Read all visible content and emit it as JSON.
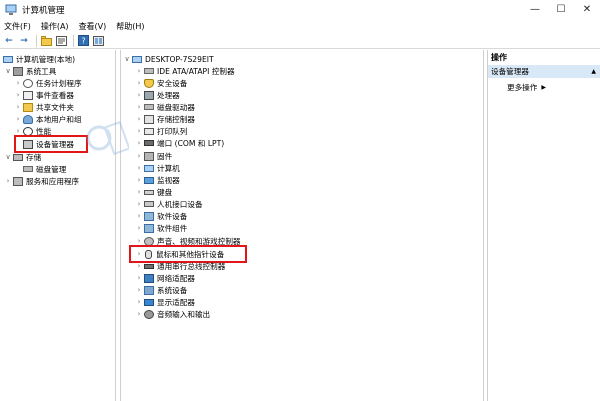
{
  "window": {
    "title": "计算机管理",
    "controls": {
      "minimize": "—",
      "maximize": "☐",
      "close": "✕"
    }
  },
  "menu": [
    "文件(F)",
    "操作(A)",
    "查看(V)",
    "帮助(H)"
  ],
  "toolbar": {
    "back_icon": "←",
    "forward_icon": "→",
    "icons": [
      "folder-up-icon",
      "properties-icon",
      "help-icon",
      "refresh-icon"
    ]
  },
  "left_tree": {
    "root": "计算机管理(本地)",
    "items": [
      {
        "label": "系统工具",
        "icon": "tools-icon",
        "expand": "∨"
      },
      {
        "label": "任务计划程序",
        "icon": "clock-icon",
        "expand": "›"
      },
      {
        "label": "事件查看器",
        "icon": "event-icon",
        "expand": "›"
      },
      {
        "label": "共享文件夹",
        "icon": "share-icon",
        "expand": "›"
      },
      {
        "label": "本地用户和组",
        "icon": "users-icon",
        "expand": "›"
      },
      {
        "label": "性能",
        "icon": "perf-icon",
        "expand": "›"
      },
      {
        "label": "设备管理器",
        "icon": "devmgr-icon",
        "expand": ""
      },
      {
        "label": "存储",
        "icon": "storage-icon",
        "expand": "∨"
      },
      {
        "label": "磁盘管理",
        "icon": "disk-icon",
        "expand": ""
      },
      {
        "label": "服务和应用程序",
        "icon": "services-icon",
        "expand": "›"
      }
    ]
  },
  "device_tree": {
    "computer": "DESKTOP-7S29EIT",
    "categories": [
      "IDE ATA/ATAPI 控制器",
      "安全设备",
      "处理器",
      "磁盘驱动器",
      "存储控制器",
      "打印队列",
      "端口 (COM 和 LPT)",
      "固件",
      "计算机",
      "监视器",
      "键盘",
      "人机接口设备",
      "软件设备",
      "软件组件",
      "声音、视频和游戏控制器",
      "鼠标和其他指针设备",
      "通用串行总线控制器",
      "网络适配器",
      "系统设备",
      "显示适配器",
      "音频输入和输出"
    ]
  },
  "actions": {
    "header": "操作",
    "section": "设备管理器",
    "section_arrow": "▲",
    "more": "更多操作",
    "more_arrow": "▶"
  },
  "highlight_color": "#e0161b",
  "selection_color": "#d9e8f7"
}
